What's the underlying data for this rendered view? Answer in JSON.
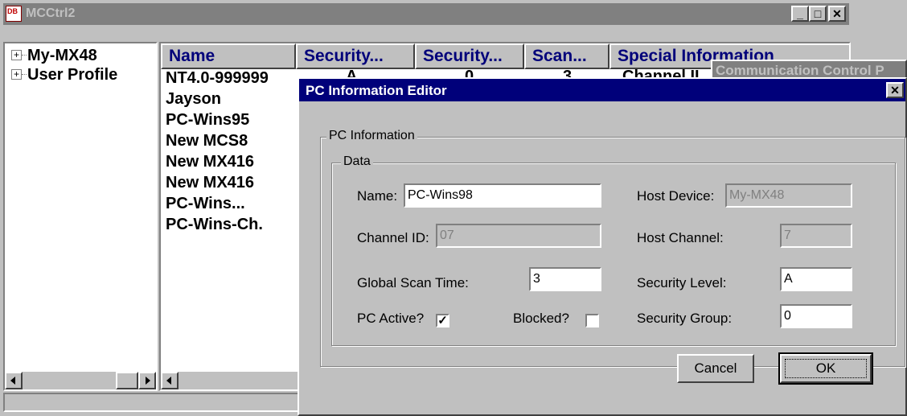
{
  "main_window": {
    "title": "MCCtrl2",
    "app_icon_text": "DB",
    "min_label": "_",
    "max_label": "□",
    "close_label": "✕"
  },
  "tree": {
    "items": [
      {
        "expander": "+",
        "label": "My-MX48"
      },
      {
        "expander": "+",
        "label": "User Profile"
      }
    ]
  },
  "list": {
    "columns": [
      "Name",
      "Security...",
      "Security...",
      "Scan...",
      "Special Information"
    ],
    "rows": [
      "NT4.0-999999",
      "Jayson",
      "PC-Wins95",
      "New MCS8",
      "New MX416",
      "New MX416",
      "PC-Wins...",
      "PC-Wins-Ch."
    ],
    "first_row_partial": [
      "A",
      "0",
      "3",
      "Channel II"
    ]
  },
  "background_window": {
    "title": "Communication Control P"
  },
  "dialog": {
    "title": "PC Information Editor",
    "close_label": "✕",
    "group_outer": "PC Information",
    "group_inner": "Data",
    "name_label": "Name:",
    "name_value": "PC-Wins98",
    "host_device_label": "Host Device:",
    "host_device_value": "My-MX48",
    "channel_id_label": "Channel ID:",
    "channel_id_value": "07",
    "host_channel_label": "Host Channel:",
    "host_channel_value": "7",
    "global_scan_label": "Global Scan Time:",
    "global_scan_value": "3",
    "security_level_label": "Security Level:",
    "security_level_value": "A",
    "pc_active_label": "PC Active?",
    "pc_active_checked": true,
    "blocked_label": "Blocked?",
    "blocked_checked": false,
    "security_group_label": "Security Group:",
    "security_group_value": "0",
    "cancel_label": "Cancel",
    "ok_label": "OK"
  },
  "colors": {
    "active_title": "#00007a",
    "inactive_title": "#808080",
    "face": "#c0c0c0"
  }
}
